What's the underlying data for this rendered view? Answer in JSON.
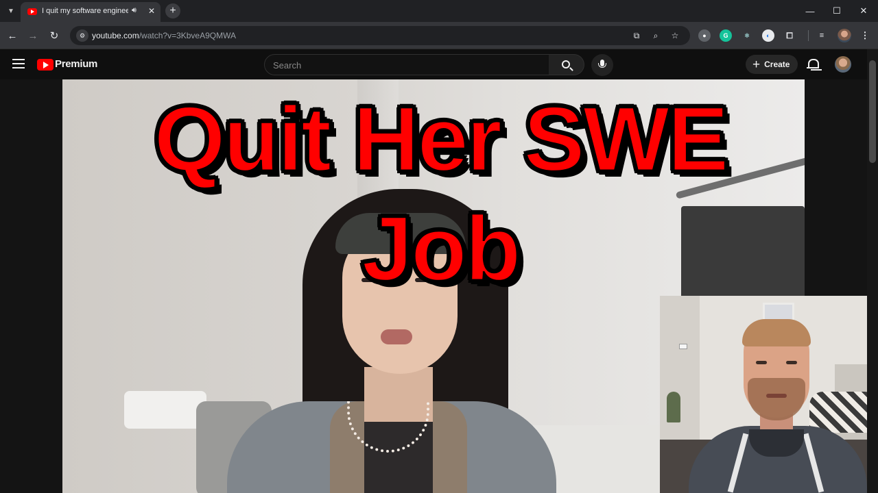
{
  "browser": {
    "tab": {
      "title": "I quit my software engineer",
      "audio_icon": "speaker-icon",
      "close_label": "✕"
    },
    "new_tab_label": "+",
    "window_controls": {
      "minimize": "—",
      "maximize": "☐",
      "close": "✕"
    },
    "nav": {
      "back": "←",
      "forward": "→",
      "reload": "↻"
    },
    "url": {
      "domain": "youtube.com",
      "path": "/watch?v=3KbveA9QMWA"
    },
    "omnibox_icons": [
      "install-icon",
      "zoom-icon",
      "bookmark-star-icon"
    ],
    "extensions": [
      "extension-1-icon",
      "grammarly-icon",
      "react-devtools-icon",
      "extension-4-icon",
      "puzzle-icon"
    ]
  },
  "youtube": {
    "brand": "Premium",
    "search": {
      "placeholder": "Search",
      "value": ""
    },
    "create_label": "Create",
    "create_plus": "+"
  },
  "video": {
    "overlay_title": "Quit Her SWE Job"
  },
  "colors": {
    "youtube_red": "#ff0000",
    "page_bg": "#0f0f0f",
    "chrome_bg": "#202124",
    "toolbar_bg": "#35363a"
  }
}
